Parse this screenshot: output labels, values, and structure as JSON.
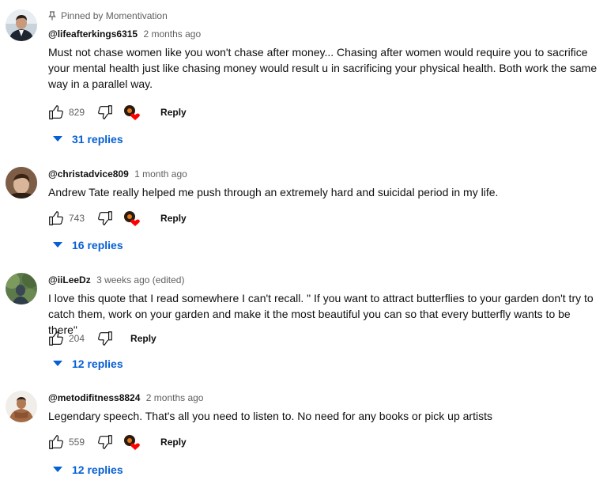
{
  "colors": {
    "link_blue": "#065fd4",
    "muted": "#606060",
    "heart_red": "#ff0000"
  },
  "comments": [
    {
      "pinned_label": "Pinned by Momentivation",
      "author": "@lifeafterkings6315",
      "time": "2 months ago",
      "text": "Must not chase women like you won't chase after money... Chasing after women would require you to sacrifice your mental health just like chasing money would result u in sacrificing your physical health. Both work the same way in a parallel way.",
      "likes": "829",
      "reply_label": "Reply",
      "creator_heart": true,
      "replies_label": "31 replies",
      "avatar_icon": "user-avatar"
    },
    {
      "author": "@christadvice809",
      "time": "1 month ago",
      "text": "Andrew Tate really helped me push through an extremely hard and suicidal period in my life.",
      "likes": "743",
      "reply_label": "Reply",
      "creator_heart": true,
      "replies_label": "16 replies",
      "avatar_icon": "user-avatar"
    },
    {
      "author": "@iiLeeDz",
      "time": "3 weeks ago (edited)",
      "text": "I love this quote that I read somewhere I can't recall. \" If you want to attract butterflies to your garden don't try to catch them, work on your garden and make it the most beautiful you can so that every butterfly wants to be there\"",
      "likes": "204",
      "reply_label": "Reply",
      "creator_heart": false,
      "replies_label": "12 replies",
      "avatar_icon": "user-avatar"
    },
    {
      "author": "@metodifitness8824",
      "time": "2 months ago",
      "text": "Legendary speech. That's all you need to listen to. No need for any books or pick up artists",
      "likes": "559",
      "reply_label": "Reply",
      "creator_heart": true,
      "replies_label": "12 replies",
      "avatar_icon": "user-avatar"
    }
  ]
}
